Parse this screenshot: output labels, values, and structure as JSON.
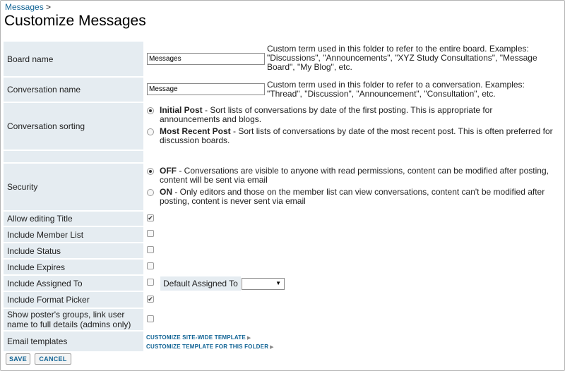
{
  "breadcrumb": {
    "link": "Messages",
    "separator": ">"
  },
  "page_title": "Customize Messages",
  "board_name": {
    "label": "Board name",
    "value": "Messages",
    "description_line1": "Custom term used in this folder to refer to the entire board. Examples:",
    "description_line2": "\"Discussions\", \"Announcements\", \"XYZ Study Consultations\", \"Message",
    "description_line3": "Board\", \"My Blog\", etc."
  },
  "conversation_name": {
    "label": "Conversation name",
    "value": "Message",
    "description_line1": "Custom term used in this folder to refer to a conversation. Examples:",
    "description_line2": "\"Thread\", \"Discussion\", \"Announcement\", \"Consultation\", etc."
  },
  "conversation_sorting": {
    "label": "Conversation sorting",
    "options": [
      {
        "title": "Initial Post",
        "line1": " - Sort lists of conversations by date of the first posting. This is appropriate for",
        "line2": "announcements and blogs.",
        "selected": true
      },
      {
        "title": "Most Recent Post",
        "line1": " - Sort lists of conversations by date of the most recent post. This is often preferred for",
        "line2": "discussion boards.",
        "selected": false
      }
    ]
  },
  "security": {
    "label": "Security",
    "options": [
      {
        "title": "OFF",
        "line1": " - Conversations are visible to anyone with read permissions, content can be modified after posting,",
        "line2": "content will be sent via email",
        "selected": true
      },
      {
        "title": "ON",
        "line1": " - Only editors and those on the member list can view conversations, content can't be modified after",
        "line2": "posting, content is never sent via email",
        "selected": false
      }
    ]
  },
  "checkbox_rows": {
    "allow_editing_title": {
      "label": "Allow editing Title",
      "checked": true
    },
    "include_member_list": {
      "label": "Include Member List",
      "checked": false
    },
    "include_status": {
      "label": "Include Status",
      "checked": false
    },
    "include_expires": {
      "label": "Include Expires",
      "checked": false
    },
    "include_assigned_to": {
      "label": "Include Assigned To",
      "checked": false
    },
    "include_format_picker": {
      "label": "Include Format Picker",
      "checked": true
    },
    "show_posters_groups": {
      "label_line1": "Show poster's groups, link user",
      "label_line2": "name to full details (admins only)",
      "checked": false
    }
  },
  "default_assigned_to": {
    "label": "Default Assigned To",
    "value": ""
  },
  "email_templates": {
    "label": "Email templates",
    "site_wide_link": "CUSTOMIZE SITE-WIDE TEMPLATE",
    "folder_link": "CUSTOMIZE TEMPLATE FOR THIS FOLDER"
  },
  "buttons": {
    "save": "SAVE",
    "cancel": "CANCEL"
  },
  "icons": {
    "check": "✔",
    "arrow": "▶",
    "caret": "▼"
  },
  "colors": {
    "label_bg": "#e5ecf1",
    "link": "#126495",
    "text": "#222222"
  }
}
